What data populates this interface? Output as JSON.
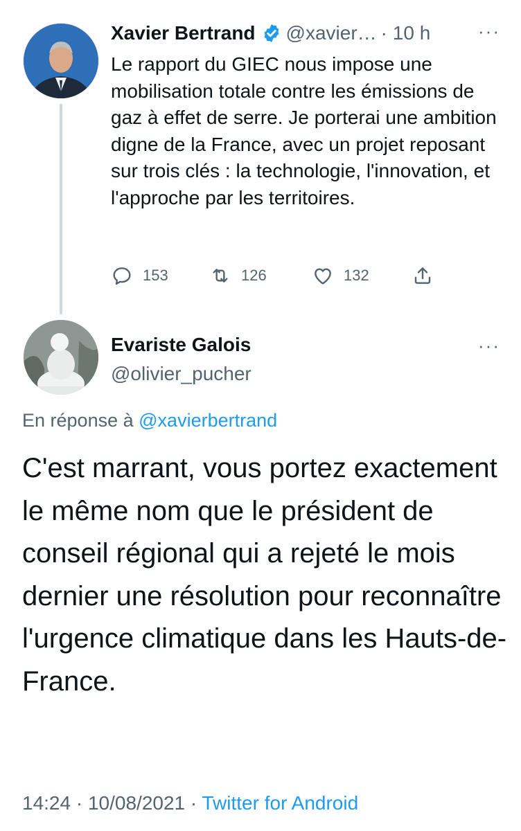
{
  "parent_tweet": {
    "author_name": "Xavier Bertrand",
    "handle": "@xavier…",
    "time": "· 10 h",
    "more": "···",
    "text": "Le rapport du GIEC nous impose une mobilisation totale contre les émissions de gaz à effet de serre. Je porterai une ambition digne de la France, avec un projet reposant sur trois clés : la technologie, l'innovation, et l'approche par les territoires.",
    "replies": "153",
    "retweets": "126",
    "likes": "132",
    "icons": {
      "verified": "verified-badge-icon",
      "reply": "reply-icon",
      "retweet": "retweet-icon",
      "like": "heart-icon",
      "share": "share-icon"
    }
  },
  "reply_tweet": {
    "author_name": "Evariste Galois",
    "handle": "@olivier_pucher",
    "more": "···",
    "in_reply_prefix": "En réponse à",
    "in_reply_mention": "@xavierbertrand",
    "text": "C'est marrant, vous portez exactement le même nom que le président de conseil régional qui a rejeté le mois dernier une résolution pour reconnaître l'urgence climatique dans les Hauts-de-France.",
    "time": "14:24",
    "date": "10/08/2021",
    "separator": "·",
    "source": "Twitter for Android"
  },
  "colors": {
    "text_primary": "#0f1419",
    "text_secondary": "#536471",
    "accent_blue": "#1d9bf0",
    "thread_line": "#cfd9de"
  }
}
